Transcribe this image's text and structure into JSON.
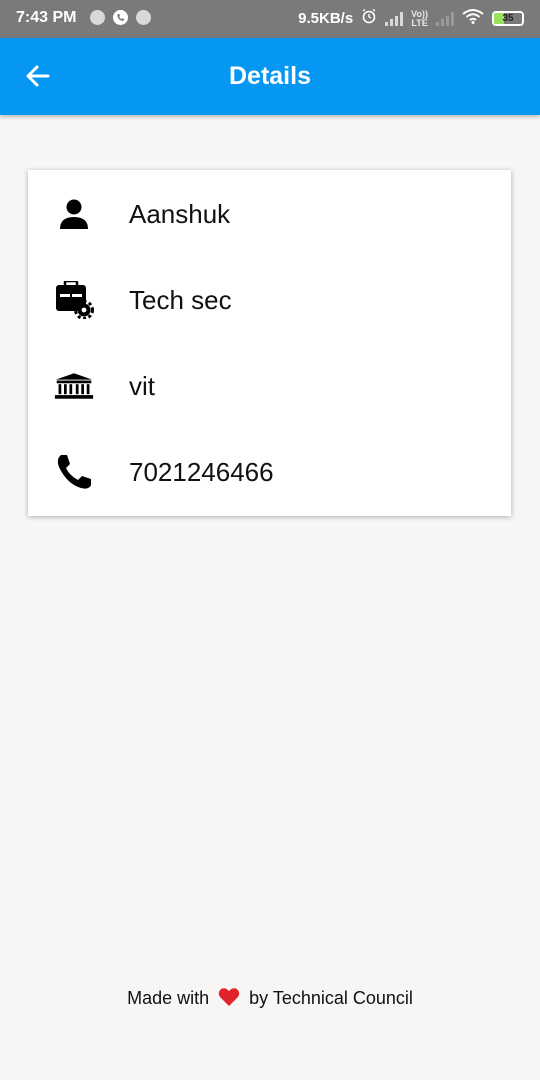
{
  "status_bar": {
    "time": "7:43 PM",
    "speed": "9.5KB/s",
    "lte_top": "Vo))",
    "lte_bottom": "LTE",
    "battery": "35"
  },
  "app_bar": {
    "title": "Details"
  },
  "details": [
    {
      "icon": "person-icon",
      "value": "Aanshuk"
    },
    {
      "icon": "briefcase-gear-icon",
      "value": "Tech sec"
    },
    {
      "icon": "institution-icon",
      "value": "vit"
    },
    {
      "icon": "phone-icon",
      "value": "7021246466"
    }
  ],
  "footer": {
    "prefix": "Made with",
    "suffix": "by Technical Council",
    "heart_color": "#e0242a"
  },
  "colors": {
    "app_bar": "#0597f2",
    "status_bar": "#7a7a7a",
    "background": "#f7f6f5"
  }
}
